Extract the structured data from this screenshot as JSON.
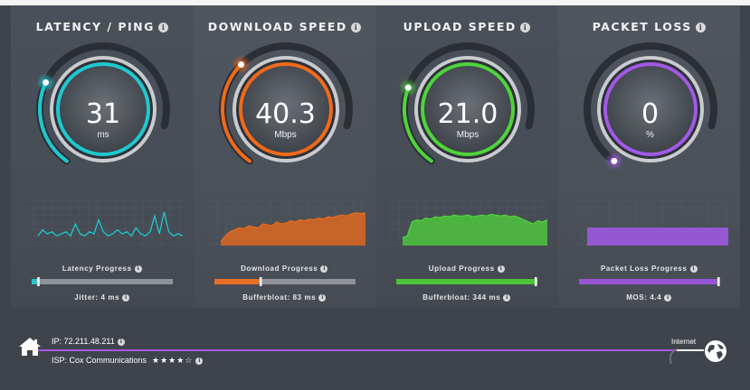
{
  "colors": {
    "latency": "#1ec8cf",
    "download": "#f06a1a",
    "upload": "#4fd43a",
    "packet_loss": "#a259e6",
    "track": "#2b2f35",
    "background": "#3f444c"
  },
  "panels": [
    {
      "title": "LATENCY / PING",
      "value": "31",
      "unit": "ms",
      "gauge_fraction": 0.32,
      "progress_label": "Latency Progress",
      "progress_fraction": 0.04,
      "stat_label": "Jitter: 4 ms"
    },
    {
      "title": "DOWNLOAD SPEED",
      "value": "40.3",
      "unit": "Mbps",
      "gauge_fraction": 0.4,
      "progress_label": "Download Progress",
      "progress_fraction": 0.32,
      "stat_label": "Bufferbloat: 83 ms"
    },
    {
      "title": "UPLOAD SPEED",
      "value": "21.0",
      "unit": "Mbps",
      "gauge_fraction": 0.3,
      "progress_label": "Upload Progress",
      "progress_fraction": 1.0,
      "stat_label": "Bufferbloat: 344 ms"
    },
    {
      "title": "PACKET LOSS",
      "value": "0",
      "unit": "%",
      "gauge_fraction": 0.0,
      "progress_label": "Packet Loss Progress",
      "progress_fraction": 1.0,
      "stat_label": "MOS: 4.4"
    }
  ],
  "connection": {
    "ip": "IP: 72.211.48.211",
    "isp": "ISP: Cox Communications",
    "rating_stars": "★★★★☆",
    "internet_label": "Internet"
  }
}
